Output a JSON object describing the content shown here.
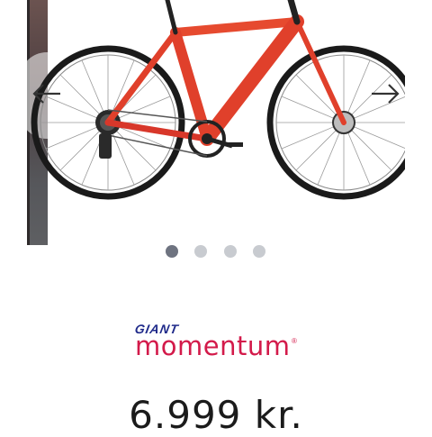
{
  "carousel": {
    "slide_count": 4,
    "active_index": 0,
    "prev_icon": "arrow-left-icon",
    "next_icon": "arrow-right-icon",
    "image_icon": "bike-image",
    "frame_color": "#e0402b"
  },
  "brand": {
    "parent": "GIANT",
    "name": "momentum",
    "reg_mark": "®",
    "parent_color": "#1f2a8a",
    "name_color": "#d31a4a"
  },
  "product": {
    "price": "6.999 kr."
  }
}
